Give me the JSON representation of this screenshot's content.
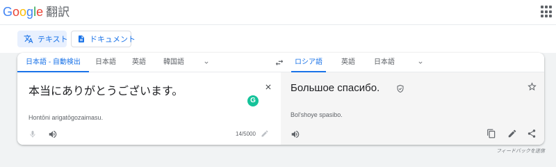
{
  "header": {
    "logo_letters": [
      "G",
      "o",
      "o",
      "g",
      "l",
      "e"
    ],
    "product": "翻訳",
    "apps_icon": "apps-grid-icon"
  },
  "modes": {
    "text_label": "テキスト",
    "text_icon": "translate-icon",
    "document_label": "ドキュメント",
    "document_icon": "document-icon"
  },
  "source_langs": [
    "日本語 - 自動検出",
    "日本語",
    "英語",
    "韓国語"
  ],
  "target_langs": [
    "ロシア語",
    "英語",
    "日本語"
  ],
  "source": {
    "text": "本当にありがとうございます。",
    "transliteration": "Hontōni arigatōgozaimasu.",
    "char_count": "14/5000",
    "grammarly_letter": "G"
  },
  "target": {
    "text": "Большое спасибо.",
    "transliteration": "Bol'shoye spasibo."
  },
  "feedback_label": "フィードバックを送信",
  "colors": {
    "accent": "#1a73e8",
    "active_mode_bg": "#e8f0fe",
    "grammarly": "#15c39a",
    "target_panel_bg": "#f5f5f5"
  }
}
